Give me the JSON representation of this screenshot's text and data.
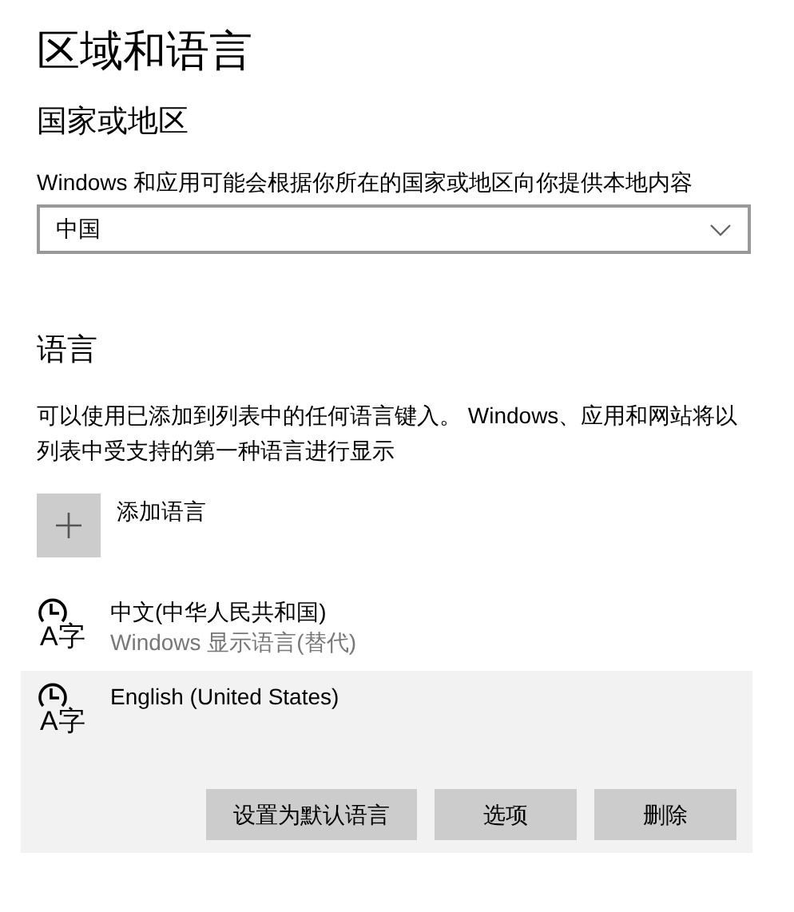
{
  "title": "区域和语言",
  "region": {
    "heading": "国家或地区",
    "description": "Windows 和应用可能会根据你所在的国家或地区向你提供本地内容",
    "dropdown": {
      "value": "中国"
    }
  },
  "language": {
    "heading": "语言",
    "description": "可以使用已添加到列表中的任何语言键入。 Windows、应用和网站将以列表中受支持的第一种语言进行显示",
    "add_label": "添加语言",
    "items": [
      {
        "name": "中文(中华人民共和国)",
        "subtitle": "Windows 显示语言(替代)",
        "icon_text": "A字",
        "selected": false
      },
      {
        "name": "English (United States)",
        "icon_text": "A字",
        "selected": true,
        "buttons": [
          "设置为默认语言",
          "选项",
          "删除"
        ]
      }
    ]
  }
}
